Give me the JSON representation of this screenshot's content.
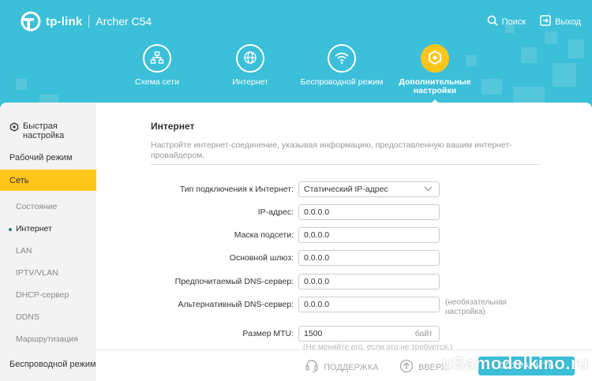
{
  "header": {
    "brand": "tp-link",
    "model": "Archer C54",
    "search_label": "Поиск",
    "logout_label": "Выход"
  },
  "nav": [
    {
      "label": "Схема сети",
      "icon": "network-map-icon"
    },
    {
      "label": "Интернет",
      "icon": "globe-icon"
    },
    {
      "label": "Беспроводной режим",
      "icon": "wifi-icon"
    },
    {
      "label": "Дополнительные настройки",
      "icon": "advanced-gear-icon",
      "active": true
    }
  ],
  "sidebar": {
    "quick_setup": "Быстрая настройка",
    "work_mode": "Рабочий режим",
    "network": "Сеть",
    "sub_items": [
      "Состояние",
      "Интернет",
      "LAN",
      "IPTV/VLAN",
      "DHCP-сервер",
      "DDNS",
      "Маршрутизация"
    ],
    "active_sub": "Интернет",
    "wireless": "Беспроводной режим"
  },
  "main": {
    "title": "Интернет",
    "description": "Настройте интернет-соединение, указывая информацию, предоставленную вашим интернет-провайдером.",
    "connection_type_label": "Тип подключения к Интернет:",
    "connection_type_value": "Статический IP-адрес",
    "ip_label": "IP-адрес:",
    "ip_value": "0.0.0.0",
    "mask_label": "Маска подсети:",
    "mask_value": "0.0.0.0",
    "gateway_label": "Основной шлюз:",
    "gateway_value": "0.0.0.0",
    "dns1_label": "Предпочитаемый DNS-сервер:",
    "dns1_value": "0.0.0.0",
    "dns2_label": "Альтернативный DNS-сервер:",
    "dns2_value": "0.0.0.0",
    "dns2_note": "(необязательная настройка)",
    "mtu_label": "Размер MTU:",
    "mtu_value": "1500",
    "mtu_unit": "байт",
    "mtu_hint": "(Не меняйте его, если это не требуется.)"
  },
  "footer": {
    "support": "ПОДДЕРЖКА",
    "top": "ВВЕРХ",
    "save": "СОХРАНИТЬ"
  },
  "watermark": "uSamodelkino.ru",
  "colors": {
    "accent": "#3cbfd8",
    "highlight": "#ffc519"
  }
}
